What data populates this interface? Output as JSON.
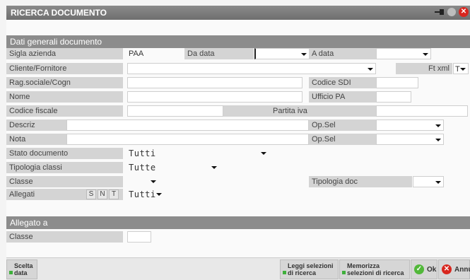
{
  "window": {
    "title": "RICERCA DOCUMENTO"
  },
  "sections": {
    "general": "Dati generali documento",
    "allegato": "Allegato a"
  },
  "labels": {
    "sigla_azienda": "Sigla azienda",
    "da_data": "Da data",
    "a_data": "A data",
    "cliente_fornitore": "Cliente/Fornitore",
    "ft_xml": "Ft xml",
    "rag_sociale": "Rag.sociale/Cogn",
    "codice_sdi": "Codice SDI",
    "nome": "Nome",
    "ufficio_pa": "Ufficio PA",
    "codice_fiscale": "Codice fiscale",
    "partita_iva": "Partita iva",
    "descriz": "Descriz",
    "op_sel_1": "Op.Sel",
    "nota": "Nota",
    "op_sel_2": "Op.Sel",
    "stato_documento": "Stato documento",
    "tipologia_classi": "Tipologia classi",
    "classe": "Classe",
    "tipologia_doc": "Tipologia doc",
    "allegati": "Allegati",
    "allegato_classe": "Classe"
  },
  "values": {
    "sigla_azienda": "PAA",
    "ft_xml": "T",
    "stato_documento": "Tutti",
    "tipologia_classi": "Tutte",
    "allegati": "Tutti"
  },
  "allegati_flags": [
    "S",
    "N",
    "T"
  ],
  "buttons": {
    "scelta_data": [
      "Scelta",
      "data"
    ],
    "leggi": [
      "Leggi selezioni",
      "di ricerca"
    ],
    "memorizza": [
      "Memorizza",
      "selezioni di ricerca"
    ],
    "ok": "Ok",
    "annulla": "Annul"
  }
}
